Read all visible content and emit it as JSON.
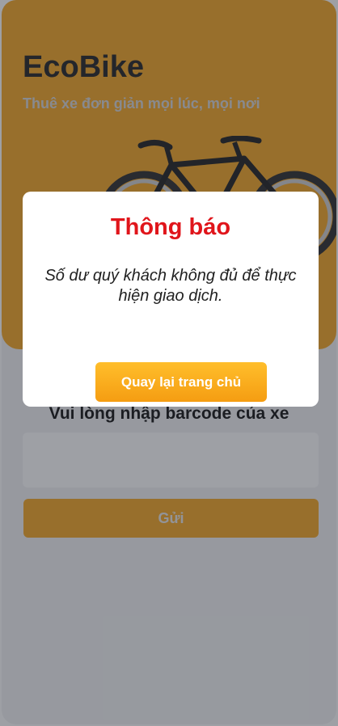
{
  "header": {
    "app_title": "EcoBike",
    "app_subtitle": "Thuê xe đơn giản mọi lúc, mọi nơi"
  },
  "form": {
    "title": "Vui lòng nhập barcode của xe",
    "input_value": "",
    "input_placeholder": "",
    "submit_label": "Gửi"
  },
  "modal": {
    "title": "Thông báo",
    "message": "Số dư quý khách không đủ để thực hiện giao dịch.",
    "button_label": "Quay lại trang chủ"
  },
  "colors": {
    "accent": "#f5a623",
    "alert_title": "#e0151b"
  },
  "icons": {
    "hero_image": "bicycle-illustration"
  }
}
